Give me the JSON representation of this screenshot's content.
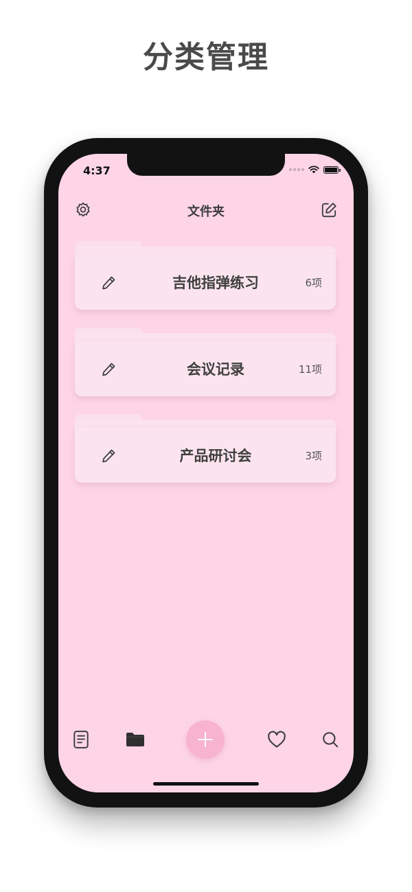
{
  "promo": {
    "title": "分类管理"
  },
  "status_bar": {
    "time": "4:37"
  },
  "header": {
    "title": "文件夹",
    "left_icon": "gear-icon",
    "right_icon": "compose-icon"
  },
  "folders": [
    {
      "name": "吉他指弹练习",
      "count": "6项"
    },
    {
      "name": "会议记录",
      "count": "11项"
    },
    {
      "name": "产品研讨会",
      "count": "3项"
    }
  ],
  "tab_bar": {
    "items": [
      "notes-icon",
      "folder-icon",
      "add-icon",
      "heart-icon",
      "search-icon"
    ]
  },
  "colors": {
    "screen_bg": "#fdd5e6",
    "card_bg": "#fbe4ee",
    "fab": "#f7b3cf",
    "text": "#3f3f3f"
  }
}
